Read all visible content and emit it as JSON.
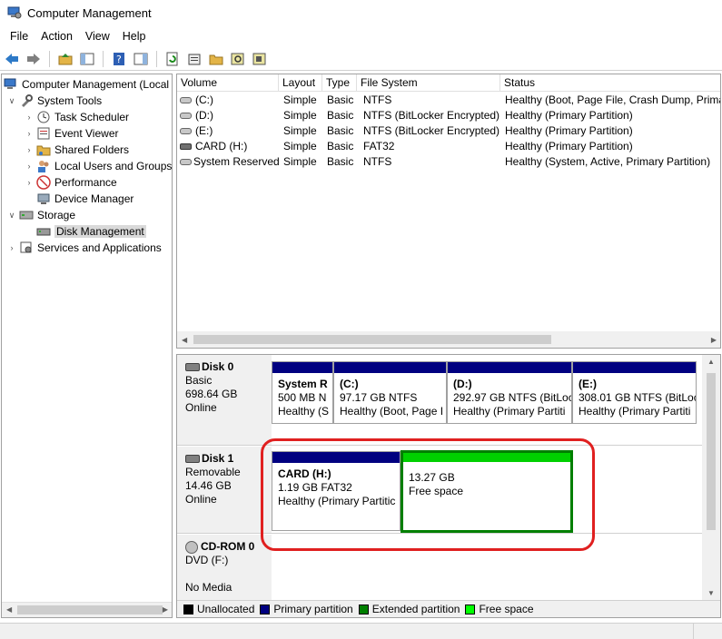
{
  "window": {
    "title": "Computer Management"
  },
  "menu": [
    "File",
    "Action",
    "View",
    "Help"
  ],
  "toolbar": {
    "icons": [
      "back-icon",
      "forward-icon",
      "up-folder-icon",
      "show-hide-tree-icon",
      "help-icon",
      "show-action-pane-icon",
      "refresh-icon",
      "properties-icon",
      "open-icon",
      "search-icon",
      "export-list-icon"
    ]
  },
  "tree": {
    "items": [
      {
        "label": "Computer Management (Local",
        "level": 0,
        "expander": "",
        "icon": "computer-management-icon"
      },
      {
        "label": "System Tools",
        "level": 1,
        "expander": "expanded",
        "icon": "system-tools-icon"
      },
      {
        "label": "Task Scheduler",
        "level": 2,
        "expander": "collapsed",
        "icon": "task-scheduler-icon"
      },
      {
        "label": "Event Viewer",
        "level": 2,
        "expander": "collapsed",
        "icon": "event-viewer-icon"
      },
      {
        "label": "Shared Folders",
        "level": 2,
        "expander": "collapsed",
        "icon": "shared-folders-icon"
      },
      {
        "label": "Local Users and Groups",
        "level": 2,
        "expander": "collapsed",
        "icon": "users-groups-icon"
      },
      {
        "label": "Performance",
        "level": 2,
        "expander": "collapsed",
        "icon": "performance-icon"
      },
      {
        "label": "Device Manager",
        "level": 2,
        "expander": "",
        "icon": "device-manager-icon"
      },
      {
        "label": "Storage",
        "level": 1,
        "expander": "expanded",
        "icon": "storage-icon"
      },
      {
        "label": "Disk Management",
        "level": 2,
        "expander": "",
        "icon": "disk-management-icon",
        "selected": true
      },
      {
        "label": "Services and Applications",
        "level": 1,
        "expander": "collapsed",
        "icon": "services-applications-icon"
      }
    ]
  },
  "volumes": {
    "columns": [
      "Volume",
      "Layout",
      "Type",
      "File System",
      "Status"
    ],
    "rows": [
      {
        "volume": "(C:)",
        "layout": "Simple",
        "type": "Basic",
        "fs": "NTFS",
        "status": "Healthy (Boot, Page File, Crash Dump, Prima"
      },
      {
        "volume": "(D:)",
        "layout": "Simple",
        "type": "Basic",
        "fs": "NTFS (BitLocker Encrypted)",
        "status": "Healthy (Primary Partition)"
      },
      {
        "volume": "(E:)",
        "layout": "Simple",
        "type": "Basic",
        "fs": "NTFS (BitLocker Encrypted)",
        "status": "Healthy (Primary Partition)"
      },
      {
        "volume": "CARD (H:)",
        "layout": "Simple",
        "type": "Basic",
        "fs": "FAT32",
        "status": "Healthy (Primary Partition)"
      },
      {
        "volume": "System Reserved",
        "layout": "Simple",
        "type": "Basic",
        "fs": "NTFS",
        "status": "Healthy (System, Active, Primary Partition)"
      }
    ]
  },
  "disks": [
    {
      "name": "Disk 0",
      "kind": "Basic",
      "size": "698.64 GB",
      "state": "Online",
      "partitions": [
        {
          "name": "System R",
          "line1": "500 MB N",
          "line2": "Healthy (S"
        },
        {
          "name": "(C:)",
          "line1": "97.17 GB NTFS",
          "line2": "Healthy (Boot, Page I"
        },
        {
          "name": "(D:)",
          "line1": "292.97 GB NTFS (BitLoc",
          "line2": "Healthy (Primary Partiti"
        },
        {
          "name": "(E:)",
          "line1": "308.01 GB NTFS (BitLoc",
          "line2": "Healthy (Primary Partiti"
        }
      ]
    },
    {
      "name": "Disk 1",
      "kind": "Removable",
      "size": "14.46 GB",
      "state": "Online",
      "partitions": [
        {
          "name": "CARD  (H:)",
          "line1": "1.19 GB FAT32",
          "line2": "Healthy (Primary Partitic"
        },
        {
          "name": "",
          "line1": "13.27 GB",
          "line2": "Free space"
        }
      ]
    },
    {
      "name": "CD-ROM 0",
      "kind": "DVD (F:)",
      "size": "",
      "state": "No Media",
      "partitions": []
    }
  ],
  "legend": [
    {
      "label": "Unallocated",
      "color": "#000000"
    },
    {
      "label": "Primary partition",
      "color": "#000080"
    },
    {
      "label": "Extended partition",
      "color": "#008000"
    },
    {
      "label": "Free space",
      "color": "#00ff00"
    }
  ]
}
